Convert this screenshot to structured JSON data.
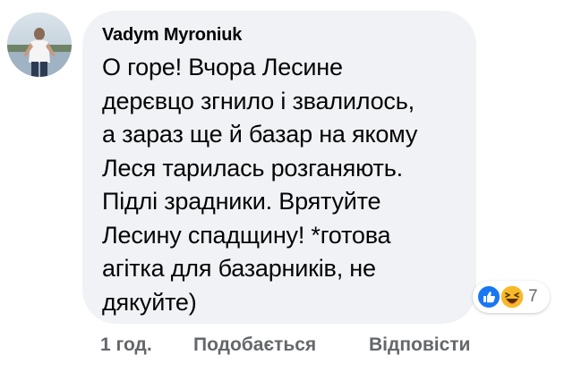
{
  "comment": {
    "author": "Vadym Myroniuk",
    "text_lines": [
      "О горе! Вчора Лесине",
      "дерєвцо згнило і звалилось,",
      "а зараз ще й базар на якому",
      "Леся тарилась розганяють.",
      "Підлі зрадники. Врятуйте",
      "Лесину спадщину! *готова",
      "агітка для базарників, не",
      "дякуйте)"
    ],
    "reactions": {
      "icons": [
        "like-icon",
        "haha-icon"
      ],
      "count": "7",
      "like_color": "#1877f2",
      "haha_color": "#f7b928"
    }
  },
  "actions": {
    "time": "1 год.",
    "like": "Подобається",
    "reply": "Відповісти"
  },
  "colors": {
    "bubble": "#f0f2f5",
    "text": "#050505",
    "secondary": "#65676b"
  }
}
